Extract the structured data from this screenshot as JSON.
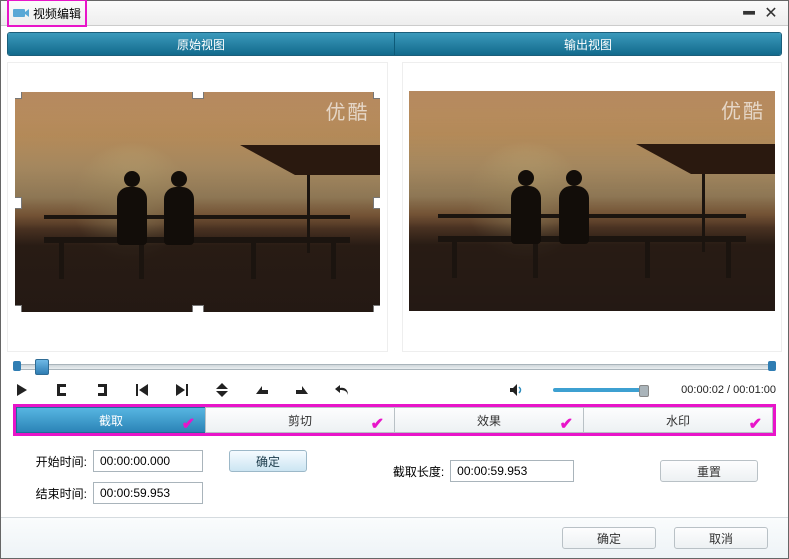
{
  "title": "视频编辑",
  "views": {
    "original": "原始视图",
    "output": "输出视图"
  },
  "watermark": "优酷",
  "playback": {
    "current": "00:00:02",
    "total": "00:01:00"
  },
  "tabs": {
    "crop": "截取",
    "trim": "剪切",
    "effect": "效果",
    "watermark": "水印"
  },
  "form": {
    "start_label": "开始时间:",
    "start_value": "00:00:00.000",
    "end_label": "结束时间:",
    "end_value": "00:00:59.953",
    "apply": "确定",
    "crop_len_label": "截取长度:",
    "crop_len_value": "00:00:59.953",
    "reset": "重置"
  },
  "footer": {
    "ok": "确定",
    "cancel": "取消"
  }
}
